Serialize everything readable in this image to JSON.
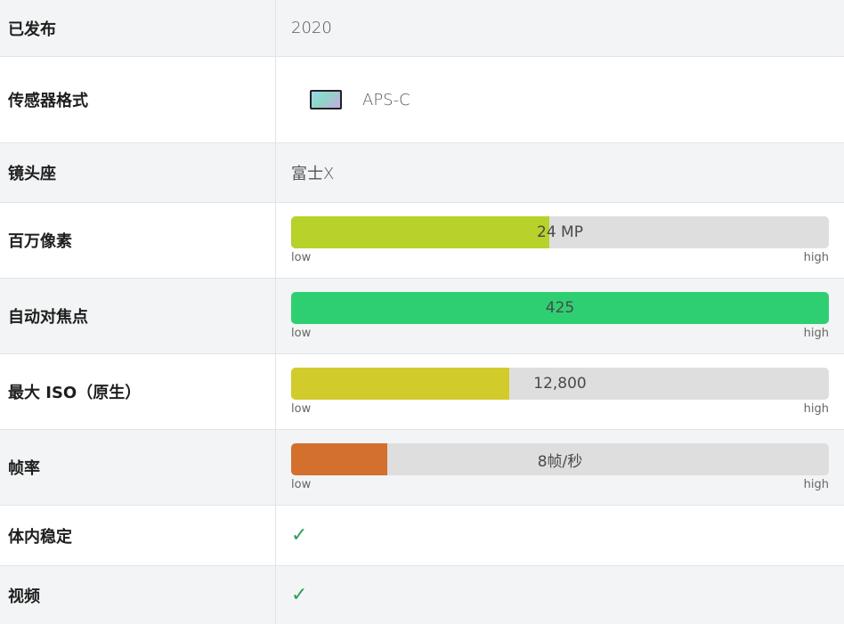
{
  "rows": {
    "released": {
      "label": "已发布",
      "value": "2020"
    },
    "sensor_format": {
      "label": "传感器格式",
      "value": "APS-C",
      "icon": "sensor-icon"
    },
    "lens_mount": {
      "label": "镜头座",
      "value": "富士X"
    },
    "megapixels": {
      "label": "百万像素",
      "value": "24 MP",
      "level": 0.48,
      "color": "#b8d12b",
      "low": "low",
      "high": "high"
    },
    "af_points": {
      "label": "自动对焦点",
      "value": "425",
      "level": 1.0,
      "color": "#2ecf72",
      "low": "low",
      "high": "high"
    },
    "max_iso": {
      "label": "最大 ISO（原生）",
      "value": "12,800",
      "level": 0.405,
      "color": "#d2cb2c",
      "low": "low",
      "high": "high"
    },
    "frame_rate": {
      "label": "帧率",
      "value": "8帧/秒",
      "level": 0.178,
      "color": "#d3702e",
      "low": "low",
      "high": "high"
    },
    "ibis": {
      "label": "体内稳定",
      "value": "✓",
      "icon": "checkmark-icon"
    },
    "video": {
      "label": "视频",
      "value": "✓",
      "icon": "checkmark-icon"
    }
  }
}
